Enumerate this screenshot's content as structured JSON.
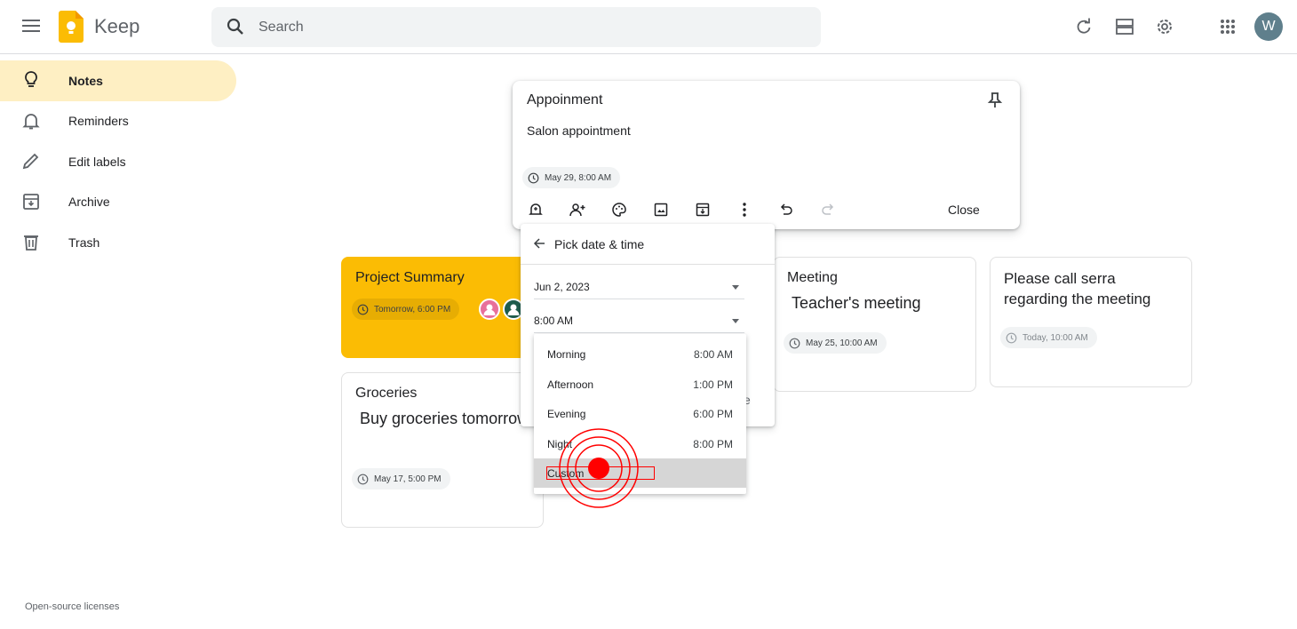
{
  "header": {
    "app_name": "Keep",
    "search_placeholder": "Search",
    "avatar_letter": "W",
    "icons": [
      "menu-icon",
      "refresh-icon",
      "list-view-icon",
      "settings-icon",
      "apps-icon"
    ]
  },
  "sidebar": {
    "items": [
      {
        "label": "Notes",
        "icon": "lightbulb-icon",
        "active": true
      },
      {
        "label": "Reminders",
        "icon": "bell-icon"
      },
      {
        "label": "Edit labels",
        "icon": "pencil-icon"
      },
      {
        "label": "Archive",
        "icon": "archive-icon"
      },
      {
        "label": "Trash",
        "icon": "trash-icon"
      }
    ],
    "footer_link": "Open-source licenses"
  },
  "editor": {
    "title": "Appoinment",
    "body": "Salon appointment",
    "reminder_chip": "May 29, 8:00 AM",
    "close_label": "Close"
  },
  "picker": {
    "title": "Pick date & time",
    "date_value": "Jun 2, 2023",
    "time_value": "8:00 AM",
    "stray_text": "e",
    "options": [
      {
        "label": "Morning",
        "time": "8:00 AM"
      },
      {
        "label": "Afternoon",
        "time": "1:00 PM"
      },
      {
        "label": "Evening",
        "time": "6:00 PM"
      },
      {
        "label": "Night",
        "time": "8:00 PM"
      },
      {
        "label": "Custom",
        "time": ""
      }
    ]
  },
  "notes": [
    {
      "title": "Project Summary",
      "body": "",
      "reminder": "Tomorrow, 6:00 PM",
      "color": "#fbbc04"
    },
    {
      "title": "Groceries",
      "body": " Buy groceries tomorrow.",
      "reminder": "May 17, 5:00 PM"
    },
    {
      "title": "Meeting",
      "body": " Teacher's meeting",
      "reminder": "May 25, 10:00 AM"
    },
    {
      "title": "",
      "body": "Please call serra regarding the meeting",
      "reminder": "Today, 10:00 AM"
    }
  ],
  "colors": {
    "accent_yellow": "#fbbc04",
    "active_nav": "#feefc3",
    "click_marker": "#ff0000"
  }
}
